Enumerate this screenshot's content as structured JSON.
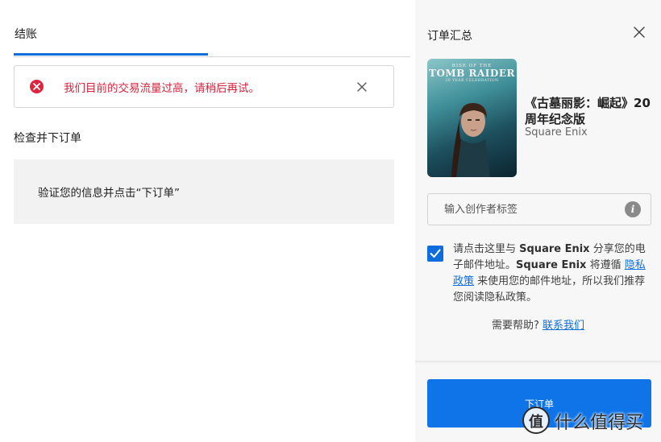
{
  "checkout": {
    "tab_label": "结账",
    "alert_message": "我们目前的交易流量过高，请稍后再试。",
    "section_title": "检查并下订单",
    "verify_text": "验证您的信息并点击“下订单”"
  },
  "summary": {
    "title": "订单汇总",
    "cover": {
      "small_text": "RISE OF THE",
      "big_text": "TOMB RAIDER",
      "sub_text": "20 YEAR CELEBRATION"
    },
    "product_title": "《古墓丽影：崛起》20 周年纪念版",
    "publisher": "Square Enix",
    "creator_tag_placeholder": "输入创作者标签",
    "consent": {
      "part1": "请点击这里与 ",
      "brand1": "Square Enix",
      "part2": " 分享您的电子邮件地址。",
      "brand2": "Square Enix",
      "part3": " 将遵循 ",
      "privacy_link": "隐私政策",
      "part4": " 来使用您的邮件地址，所以我们推荐您阅读隐私政策。"
    },
    "help_text": "需要帮助?",
    "contact_link": "联系我们",
    "place_order_label": "下订单"
  },
  "watermark": {
    "logo_char": "值",
    "text": "什么值得买"
  },
  "colors": {
    "accent": "#0e6ddc",
    "error": "#d6233b",
    "summary_bg": "#f7f7f7"
  },
  "icons": [
    "error-icon",
    "close-icon",
    "info-icon",
    "checkmark-icon"
  ]
}
